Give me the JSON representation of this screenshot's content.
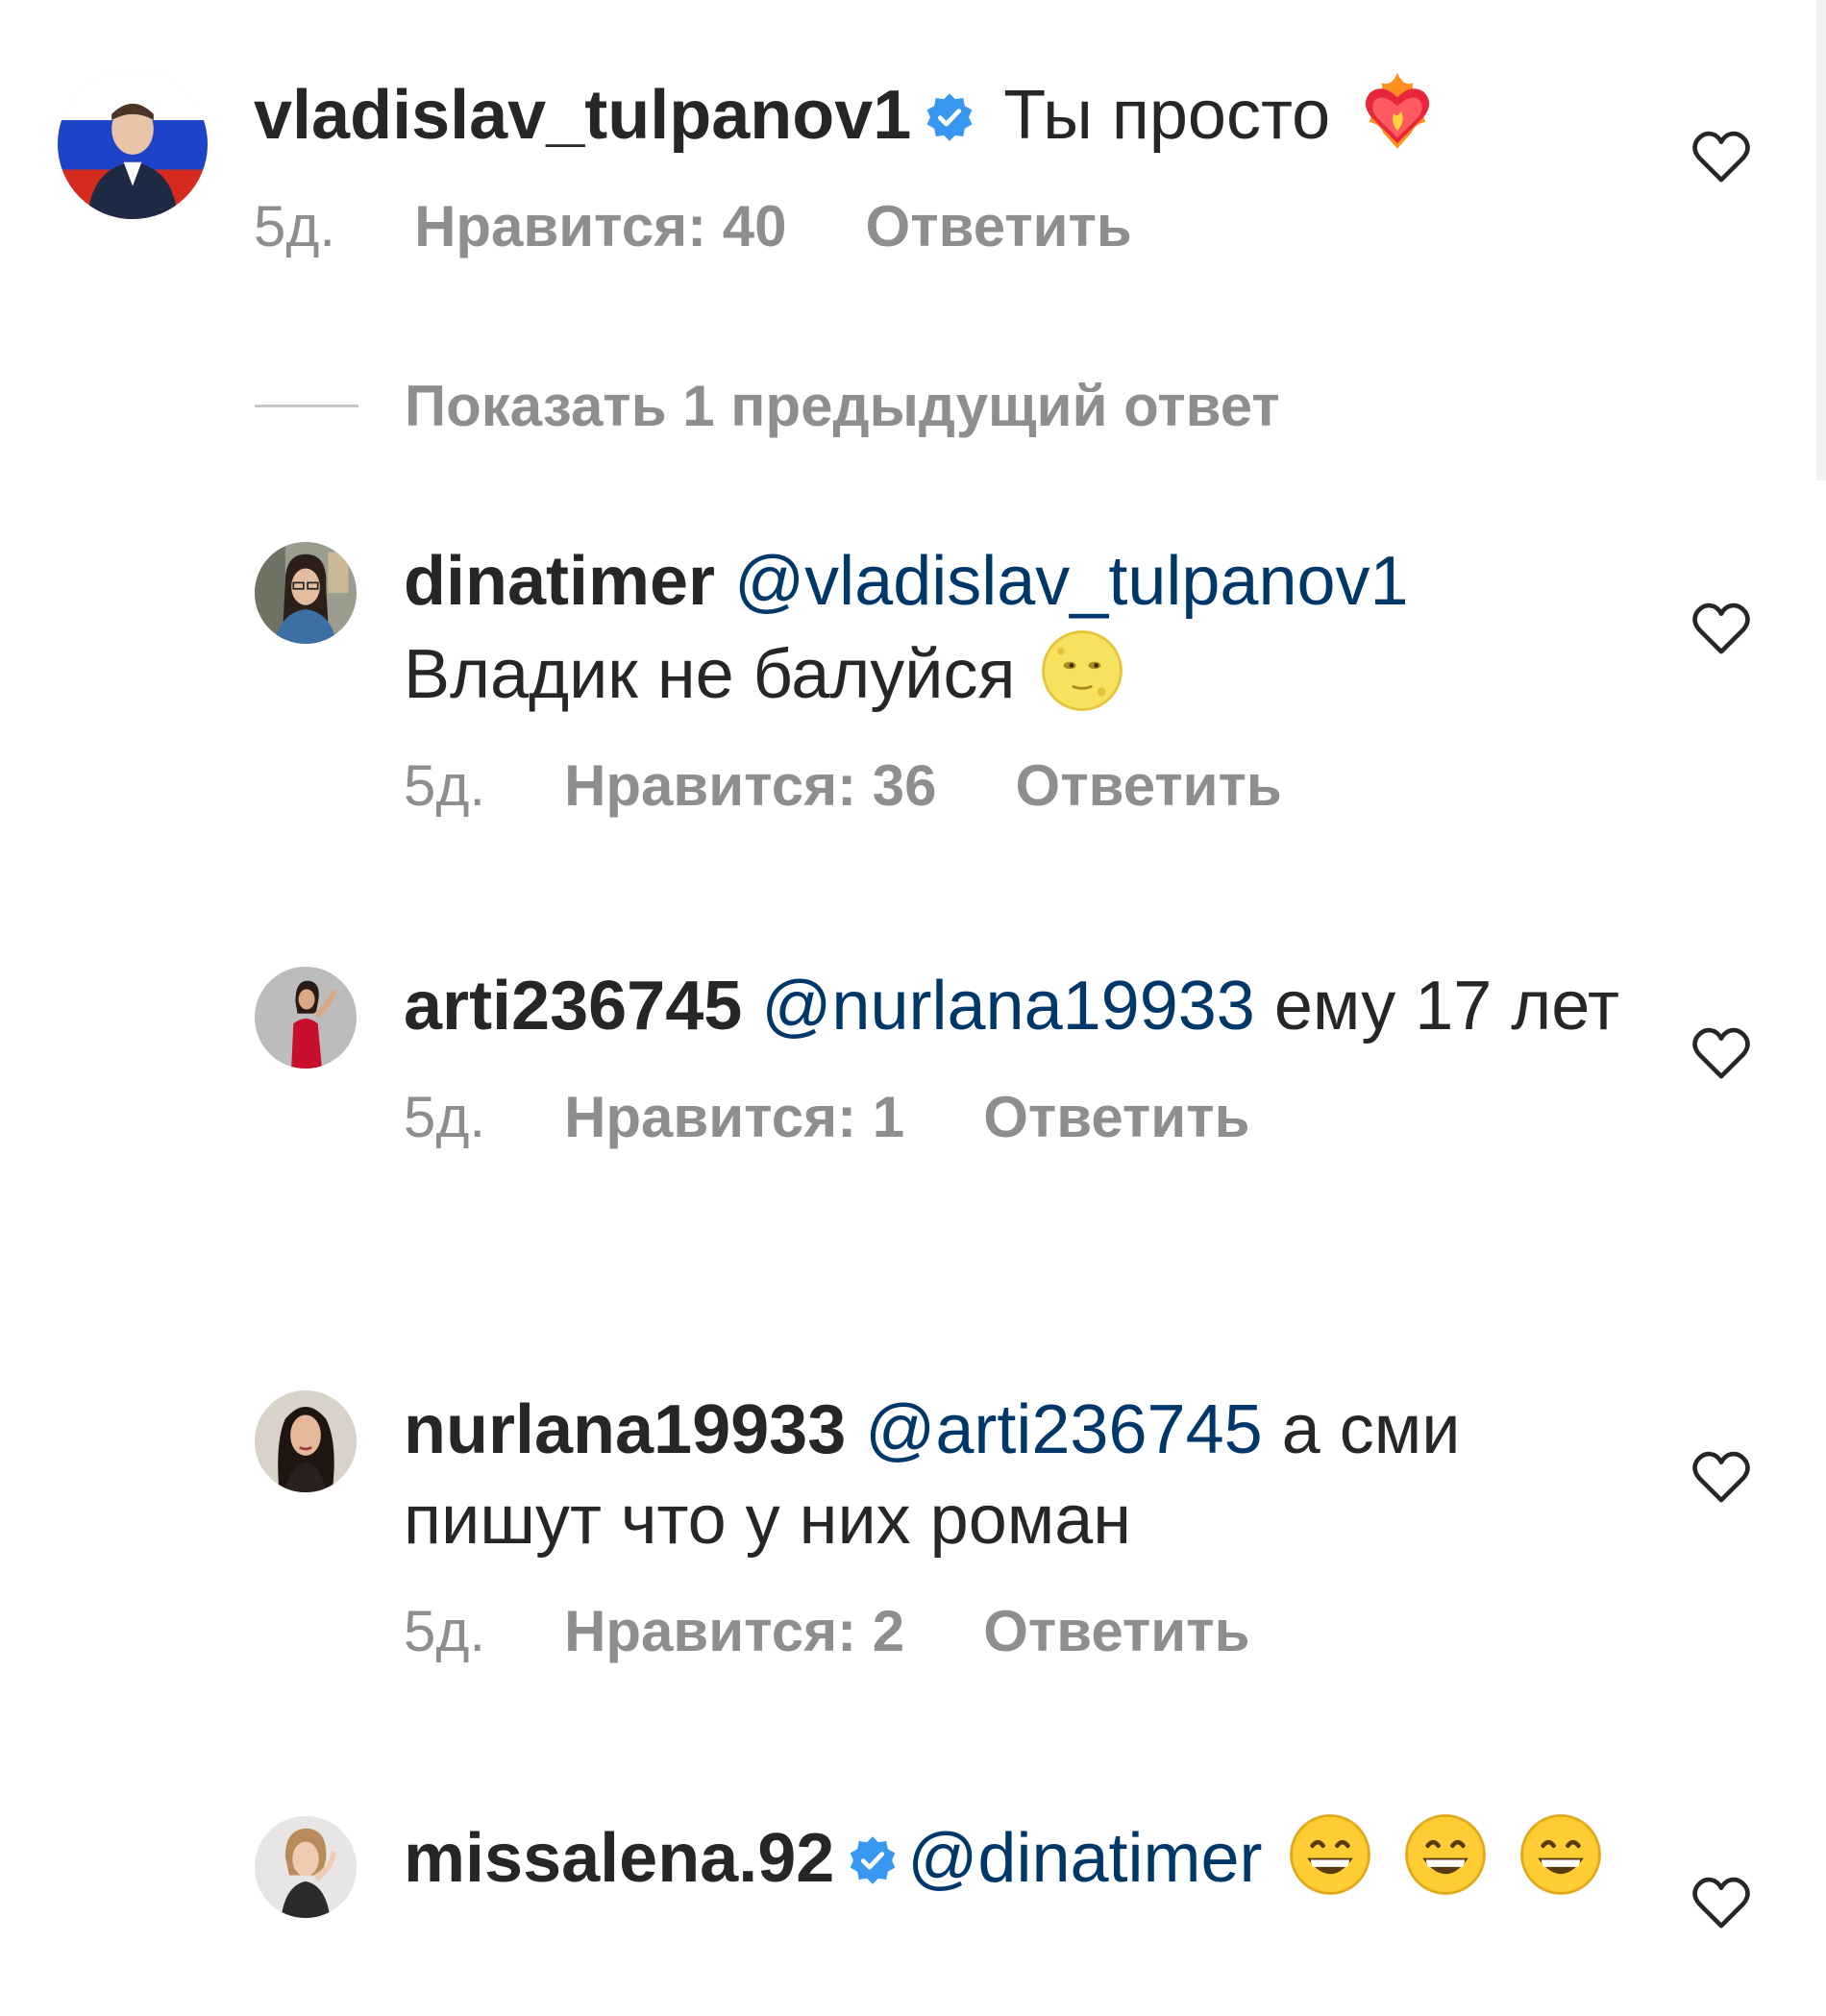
{
  "comments": [
    {
      "username": "vladislav_tulpanov1",
      "verified": true,
      "mention": "",
      "text": "Ты просто",
      "emojis_after": [
        "heart-on-fire"
      ],
      "time": "5д.",
      "likes": "Нравится: 40",
      "reply": "Ответить",
      "avatar_icon": "avatar-russian-flag"
    },
    {
      "username": "dinatimer",
      "verified": false,
      "mention": "@vladislav_tulpanov1",
      "text": "Владик не балуйся",
      "emojis_after": [
        "moon-face"
      ],
      "time": "5д.",
      "likes": "Нравится: 36",
      "reply": "Ответить",
      "avatar_icon": "avatar-woman-glasses"
    },
    {
      "username": "arti236745",
      "verified": false,
      "mention": "@nurlana19933",
      "text": "ему 17 лет",
      "emojis_after": [],
      "time": "5д.",
      "likes": "Нравится: 1",
      "reply": "Ответить",
      "avatar_icon": "avatar-woman-red-dress"
    },
    {
      "username": "nurlana19933",
      "verified": false,
      "mention": "@arti236745",
      "text": "а сми пишут что у них роман",
      "emojis_after": [],
      "time": "5д.",
      "likes": "Нравится: 2",
      "reply": "Ответить",
      "avatar_icon": "avatar-woman-dark-hair"
    },
    {
      "username": "missalena.92",
      "verified": true,
      "mention": "@dinatimer",
      "text": "",
      "emojis_after": [
        "grinning-face",
        "grinning-face",
        "grinning-face"
      ],
      "time": "",
      "likes": "",
      "reply": "",
      "avatar_icon": "avatar-woman-light"
    }
  ],
  "show_previous": "Показать 1 предыдущий ответ",
  "icons": {
    "like": "heart-outline-icon",
    "verified": "verified-badge-icon"
  },
  "colors": {
    "text": "#262626",
    "meta": "#8e8e8e",
    "mention": "#00376b",
    "verified": "#3897f0"
  }
}
